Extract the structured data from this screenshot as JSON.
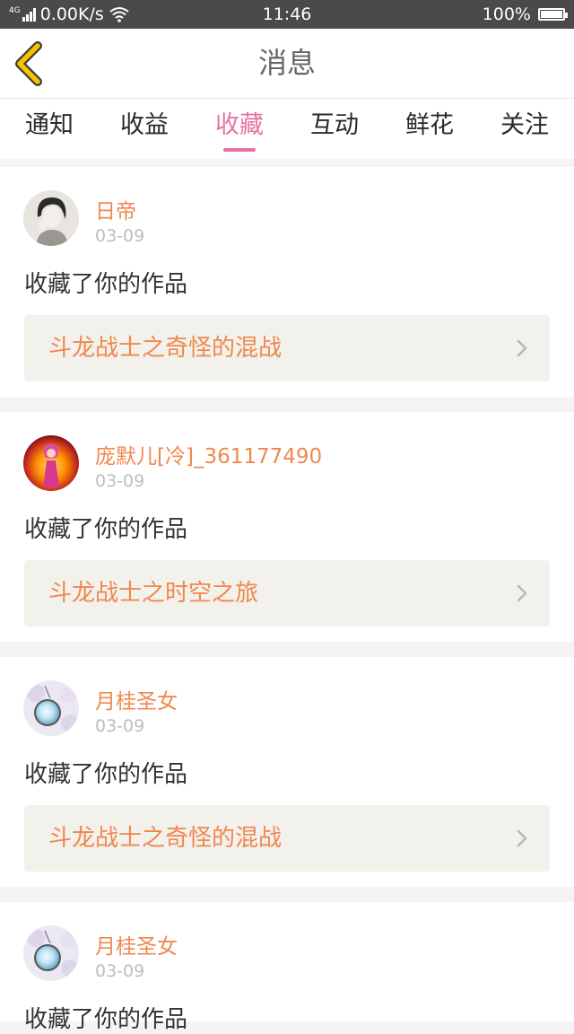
{
  "status_bar": {
    "network": "4G",
    "speed": "0.00K/s",
    "time": "11:46",
    "battery": "100%"
  },
  "nav": {
    "title": "消息",
    "back_icon": "chevron-left-icon",
    "accent_color": "#f5c400"
  },
  "tabs": [
    {
      "label": "通知",
      "active": false
    },
    {
      "label": "收益",
      "active": false
    },
    {
      "label": "收藏",
      "active": true
    },
    {
      "label": "互动",
      "active": false
    },
    {
      "label": "鲜花",
      "active": false
    },
    {
      "label": "关注",
      "active": false
    }
  ],
  "colors": {
    "active_tab": "#e672a5",
    "username": "#f0884e",
    "work_title": "#f0884e"
  },
  "messages": [
    {
      "username": "日帝",
      "date": "03-09",
      "action": "收藏了你的作品",
      "work_title": "斗龙战士之奇怪的混战",
      "avatar": "avatar-boy-sketch"
    },
    {
      "username": "庞默儿[冷]_361177490",
      "date": "03-09",
      "action": "收藏了你的作品",
      "work_title": "斗龙战士之时空之旅",
      "avatar": "avatar-fire-fairy"
    },
    {
      "username": "月桂圣女",
      "date": "03-09",
      "action": "收藏了你的作品",
      "work_title": "斗龙战士之奇怪的混战",
      "avatar": "avatar-crystal-pendant"
    },
    {
      "username": "月桂圣女",
      "date": "03-09",
      "action": "收藏了你的作品",
      "work_title": "",
      "avatar": "avatar-crystal-pendant"
    }
  ]
}
